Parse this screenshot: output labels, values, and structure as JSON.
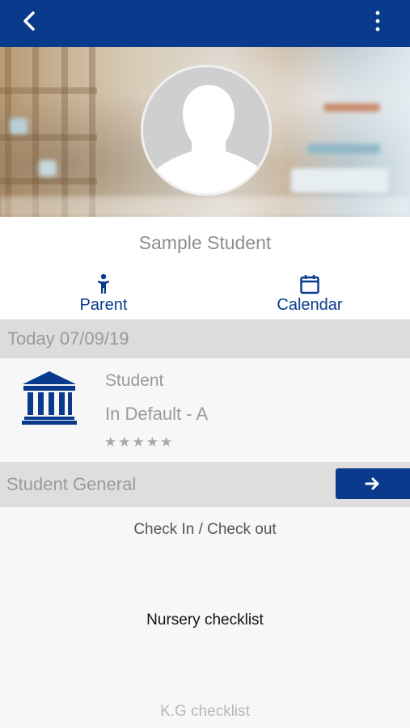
{
  "header": {
    "back_icon": "chevron-left-icon",
    "menu_icon": "more-vertical-icon",
    "color": "#0a3a8c"
  },
  "profile": {
    "name": "Sample Student",
    "avatar_icon": "user-silhouette-icon"
  },
  "actions": [
    {
      "label": "Parent",
      "icon": "child-person-icon"
    },
    {
      "label": "Calendar",
      "icon": "calendar-icon"
    }
  ],
  "today": {
    "label": "Today 07/09/19"
  },
  "student": {
    "icon": "institution-building-icon",
    "title": "Student",
    "subtitle": "In Default - A",
    "rating": "★★★★★"
  },
  "section": {
    "label": "Student General",
    "go_icon": "arrow-right-icon"
  },
  "list": {
    "items": [
      {
        "label": "Check In / Check out",
        "color": "#555555"
      },
      {
        "label": "Nursery checklist",
        "color": "#111111"
      },
      {
        "label": "K.G checklist",
        "color": "#b8b8b8"
      }
    ]
  },
  "colors": {
    "primary": "#0a3a8c",
    "muted_text": "#9a9a9a",
    "band": "#dcdcdc"
  }
}
